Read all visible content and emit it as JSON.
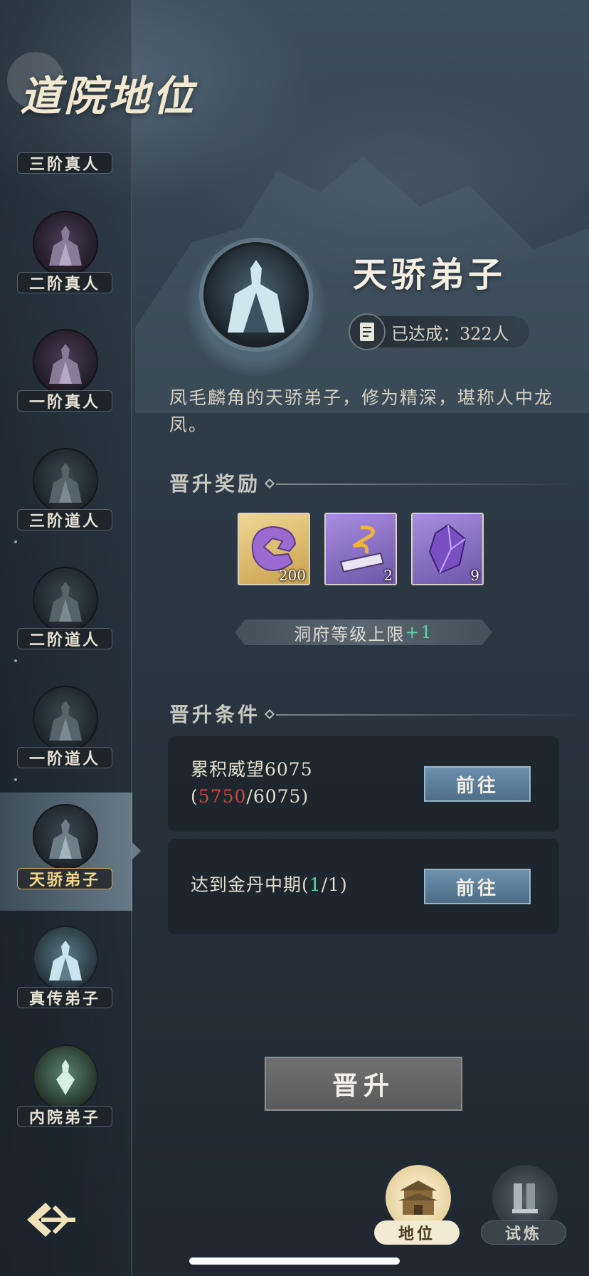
{
  "page": {
    "title": "道院地位"
  },
  "sidebar": {
    "items": [
      {
        "label": "三阶真人",
        "icon": "robed-figure-icon",
        "style": "top"
      },
      {
        "label": "二阶真人",
        "icon": "robed-figure-icon",
        "style": "purple"
      },
      {
        "label": "一阶真人",
        "icon": "robed-figure-icon",
        "style": "purple"
      },
      {
        "label": "三阶道人",
        "icon": "robed-figure-icon",
        "style": "dark"
      },
      {
        "label": "二阶道人",
        "icon": "robed-figure-icon",
        "style": "dark"
      },
      {
        "label": "一阶道人",
        "icon": "robed-figure-icon",
        "style": "dark"
      },
      {
        "label": "天骄弟子",
        "icon": "robed-figure-icon",
        "style": "active"
      },
      {
        "label": "真传弟子",
        "icon": "robed-figure-icon",
        "style": "bright"
      },
      {
        "label": "内院弟子",
        "icon": "robed-figure-icon",
        "style": "green"
      }
    ],
    "selected": "天骄弟子"
  },
  "detail": {
    "rank_name": "天骄弟子",
    "achieved_text": "已达成：322人",
    "description": "凤毛麟角的天骄弟子，修为精深，堪称人中龙凤。"
  },
  "rewards": {
    "title": "晋升奖励",
    "items": [
      {
        "icon": "jade-token-icon",
        "count": "200",
        "rarity": "gold"
      },
      {
        "icon": "scroll-icon",
        "count": "2",
        "rarity": "purple"
      },
      {
        "icon": "purple-crystal-icon",
        "count": "9",
        "rarity": "purple"
      }
    ],
    "cap_text": "洞府等级上限",
    "cap_bonus": "+1"
  },
  "conditions": {
    "title": "晋升条件",
    "items": [
      {
        "line1": "累积威望6075",
        "open": "(",
        "current": "5750",
        "rest": "/6075)",
        "button": "前往"
      },
      {
        "prefix": "达到金丹中期(",
        "current": "1",
        "rest": "/1)",
        "button": "前往"
      }
    ]
  },
  "promote_button": "晋升",
  "bottom_nav": [
    {
      "label": "地位",
      "icon": "palace-icon",
      "active": true
    },
    {
      "label": "试炼",
      "icon": "trial-icon",
      "active": false
    }
  ],
  "colors": {
    "accent_gold": "#f4d889",
    "progress_red": "#d8443c",
    "progress_green": "#5fd6a8",
    "button_blue": "#5c7f9b"
  }
}
